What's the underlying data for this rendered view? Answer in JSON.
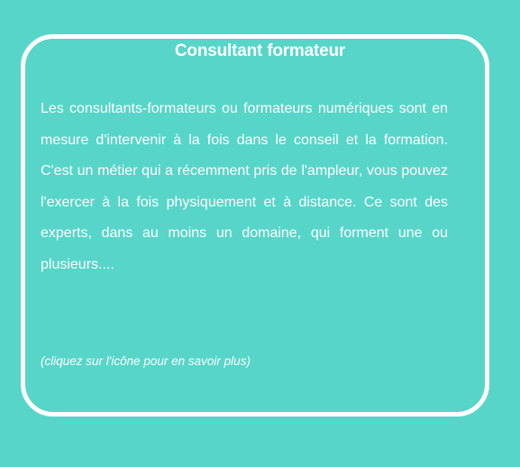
{
  "card": {
    "title": "Consultant formateur",
    "description": "Les consultants-formateurs ou formateurs numériques sont en mesure d'intervenir à la fois dans le conseil et la formation. C'est un métier qui a récemment pris de l'ampleur, vous pouvez l'exercer à la fois physiquement et à distance. Ce sont des experts, dans au moins un domaine, qui forment une ou plusieurs....",
    "hint": "(cliquez sur l'icône pour en savoir plus)"
  },
  "colors": {
    "background": "#57d5c8",
    "text": "#ffffff",
    "border": "#ffffff"
  }
}
